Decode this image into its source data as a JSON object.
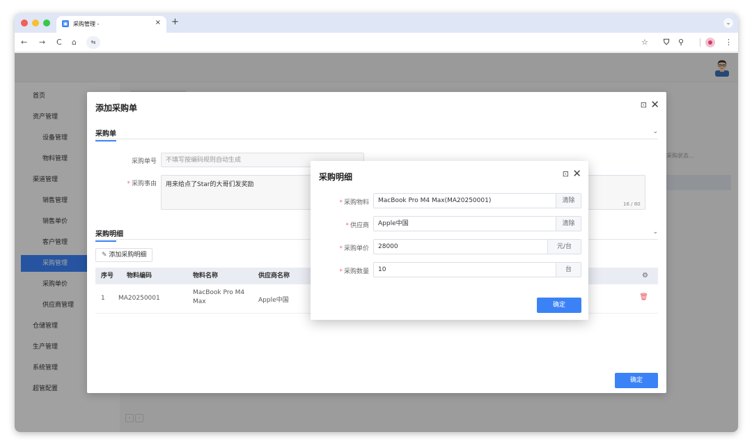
{
  "browser": {
    "tab_title": "采购管理 -",
    "tab_close": "×",
    "new_tab": "+",
    "tab_menu": "⌄",
    "nav_back": "←",
    "nav_forward": "→",
    "nav_reload": "C",
    "nav_home": "⌂",
    "site_settings": "⇆",
    "bookmark_star": "☆",
    "extensions": "⚲",
    "more": "⋮"
  },
  "sidebar": {
    "items": [
      {
        "label": "首页",
        "level": "top"
      },
      {
        "label": "资产管理",
        "level": "top"
      },
      {
        "label": "设备管理",
        "level": "sub"
      },
      {
        "label": "物料管理",
        "level": "sub"
      },
      {
        "label": "渠道管理",
        "level": "top"
      },
      {
        "label": "销售管理",
        "level": "sub"
      },
      {
        "label": "销售单价",
        "level": "sub"
      },
      {
        "label": "客户管理",
        "level": "sub"
      },
      {
        "label": "采购管理",
        "level": "sub",
        "active": true
      },
      {
        "label": "采购单价",
        "level": "sub"
      },
      {
        "label": "供应商管理",
        "level": "sub"
      },
      {
        "label": "仓储管理",
        "level": "top"
      },
      {
        "label": "生产管理",
        "level": "top"
      },
      {
        "label": "系统管理",
        "level": "top"
      },
      {
        "label": "超管配置",
        "level": "top"
      }
    ]
  },
  "background": {
    "status_select_placeholder": "采购状态..."
  },
  "outer_dialog": {
    "title": "添加采购单",
    "maximize_icon": "⊡",
    "close_icon": "✕",
    "section1": "采购单",
    "order_no_label": "采购单号",
    "order_no_placeholder": "不填写按编码规则自动生成",
    "reason_label": "采购事由",
    "reason_value": "用来给点了Star的大哥们发奖励",
    "reason_counter": "16 / 80",
    "section2": "采购明细",
    "add_detail_button": "添加采购明细",
    "table": {
      "headers": [
        "序号",
        "物料编码",
        "物料名称",
        "供应商名称"
      ],
      "rows": [
        {
          "index": "1",
          "code": "MA20250001",
          "name": "MacBook Pro M4 Max",
          "supplier": "Apple中国"
        }
      ]
    },
    "confirm_button": "确定"
  },
  "inner_dialog": {
    "title": "采购明细",
    "maximize_icon": "⊡",
    "close_icon": "✕",
    "fields": {
      "material_label": "采购物料",
      "material_value": "MacBook Pro M4 Max(MA20250001)",
      "material_clear": "清除",
      "supplier_label": "供应商",
      "supplier_value": "Apple中国",
      "supplier_clear": "清除",
      "price_label": "采购单价",
      "price_value": "28000",
      "price_unit": "元/台",
      "qty_label": "采购数量",
      "qty_value": "10",
      "qty_unit": "台"
    },
    "confirm_button": "确定"
  },
  "colors": {
    "accent": "#3b82f6",
    "danger": "#e25656",
    "required": "#f56c6c"
  }
}
